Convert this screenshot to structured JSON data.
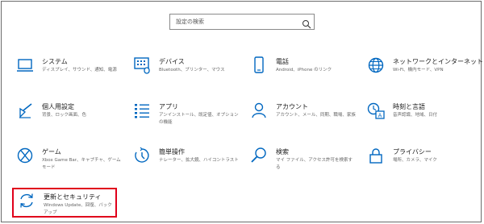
{
  "search": {
    "placeholder": "設定の検索",
    "icon": "search-icon"
  },
  "accent_color": "#0067c0",
  "highlight_color": "#e0001b",
  "tiles": {
    "system": {
      "title": "システム",
      "desc": "ディスプレイ、サウンド、通知、電源",
      "icon": "laptop-icon"
    },
    "devices": {
      "title": "デバイス",
      "desc": "Bluetooth、プリンター、マウス",
      "icon": "keyboard-icon"
    },
    "phone": {
      "title": "電話",
      "desc": "Android、iPhone のリンク",
      "icon": "phone-icon"
    },
    "network": {
      "title": "ネットワークとインターネット",
      "desc": "Wi-Fi、機内モード、VPN",
      "icon": "globe-icon"
    },
    "personalization": {
      "title": "個人用設定",
      "desc": "背景、ロック画面、色",
      "icon": "brush-icon"
    },
    "apps": {
      "title": "アプリ",
      "desc": "アンインストール、既定値、オプションの機能",
      "icon": "list-icon"
    },
    "accounts": {
      "title": "アカウント",
      "desc": "アカウント、メール、同期、職場、家族",
      "icon": "person-icon"
    },
    "time": {
      "title": "時刻と言語",
      "desc": "音声認識、地域、日付",
      "icon": "time-language-icon"
    },
    "gaming": {
      "title": "ゲーム",
      "desc": "Xbox Game Bar、キャプチャ、ゲーム モード",
      "icon": "xbox-icon"
    },
    "ease": {
      "title": "簡単操作",
      "desc": "ナレーター、拡大鏡、ハイコントラスト",
      "icon": "ease-of-access-icon"
    },
    "search": {
      "title": "検索",
      "desc": "マイ ファイル、アクセス許可を検索する",
      "icon": "search-icon"
    },
    "privacy": {
      "title": "プライバシー",
      "desc": "場所、カメラ、マイク",
      "icon": "lock-icon"
    },
    "update": {
      "title": "更新とセキュリティ",
      "desc": "Windows Update、回復、バックアップ",
      "icon": "sync-icon"
    }
  }
}
